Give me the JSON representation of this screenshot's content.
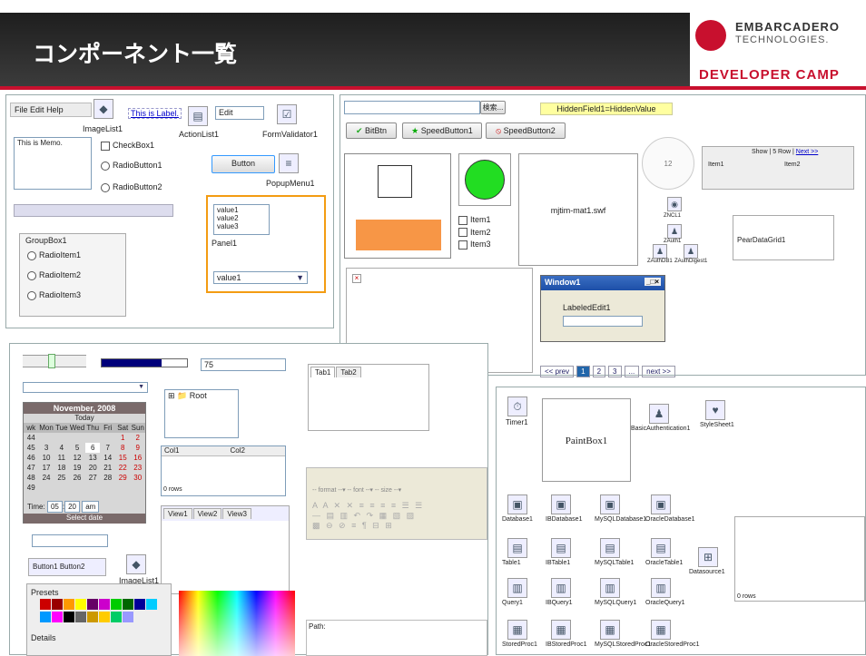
{
  "header": {
    "title": "コンポーネント一覧",
    "logo_line1": "EMBARCADERO",
    "logo_line2": "TECHNOLOGIES.",
    "logo_line3": "DEVELOPER CAMP"
  },
  "p1": {
    "menu": [
      "File",
      "Edit",
      "Help"
    ],
    "imagelist": "ImageList1",
    "label": "This is Label.",
    "actionlist": "ActionList1",
    "edit": "Edit",
    "formvalidator": "FormValidator1",
    "memo": "This is Memo.",
    "checkbox": "CheckBox1",
    "radio1": "RadioButton1",
    "radio2": "RadioButton2",
    "button": "Button",
    "popup": "PopupMenu1",
    "listvals": [
      "value1",
      "value2",
      "value3"
    ],
    "panel": "Panel1",
    "combo": "value1",
    "groupbox": "GroupBox1",
    "radioitems": [
      "RadioItem1",
      "RadioItem2",
      "RadioItem3"
    ]
  },
  "p2": {
    "search": "検索...",
    "hidden": "HiddenField1=HiddenValue",
    "bitbtn": "BitBtn",
    "speed1": "SpeedButton1",
    "speed2": "SpeedButton2",
    "flash": "mjtim-mat1.swf",
    "items": [
      "Item1",
      "Item2",
      "Item3"
    ],
    "grid_head": [
      "Item1",
      "Item2"
    ],
    "grid_nav": "Show | 5 Row | ",
    "grid_nav_link": "Next >>",
    "zdb": [
      "ZNCL1",
      "ZAuth1",
      "ZAuthDB1",
      "ZAuthDigest1"
    ],
    "pear": "PearDataGrid1",
    "window": "Window1",
    "labelededit": "LabeledEdit1",
    "pages": {
      "prev": "<< prev",
      "next": "next >>",
      "nums": [
        "1",
        "2",
        "3",
        "..."
      ]
    }
  },
  "p3": {
    "spin": "75",
    "cal_title": "November, 2008",
    "today": "Today",
    "days": [
      "wk",
      "Mon",
      "Tue",
      "Wed",
      "Thu",
      "Fri",
      "Sat",
      "Sun"
    ],
    "weeks": [
      [
        "44",
        "",
        "",
        "",
        "",
        "",
        "1",
        "2"
      ],
      [
        "45",
        "3",
        "4",
        "5",
        "6",
        "7",
        "8",
        "9"
      ],
      [
        "46",
        "10",
        "11",
        "12",
        "13",
        "14",
        "15",
        "16"
      ],
      [
        "47",
        "17",
        "18",
        "19",
        "20",
        "21",
        "22",
        "23"
      ],
      [
        "48",
        "24",
        "25",
        "26",
        "27",
        "28",
        "29",
        "30"
      ],
      [
        "49",
        "",
        "",
        "",
        "",
        "",
        "",
        ""
      ]
    ],
    "time_lbl": "Time:",
    "time_h": "05",
    "time_m": "20",
    "ampm": "am",
    "select_date": "Select date",
    "tree_root": "Root",
    "cols": [
      "Col1",
      "Col2"
    ],
    "rows": "0 rows",
    "views": [
      "View1",
      "View2",
      "View3"
    ],
    "tabs": [
      "Tab1",
      "Tab2"
    ],
    "btn1": "Button1",
    "btn2": "Button2",
    "imagelist": "ImageList1",
    "presets": "Presets",
    "details": "Details",
    "format": "-- format --",
    "font": "-- font --",
    "size": "-- size --",
    "path": "Path:"
  },
  "p4": {
    "timer": "Timer1",
    "paintbox": "PaintBox1",
    "basicauth": "BasicAuthentication1",
    "stylesheet": "StyleSheet1",
    "db": [
      "Database1",
      "IBDatabase1",
      "MySQLDatabase1",
      "OracleDatabase1"
    ],
    "tables": [
      "Table1",
      "IBTable1",
      "MySQLTable1",
      "OracleTable1"
    ],
    "datasource": "Datasource1",
    "queries": [
      "Query1",
      "IBQuery1",
      "MySQLQuery1",
      "OracleQuery1"
    ],
    "procs": [
      "StoredProc1",
      "IBStoredProc1",
      "MySQLStoredProc1",
      "OracleStoredProc1"
    ],
    "rows": "0 rows"
  }
}
